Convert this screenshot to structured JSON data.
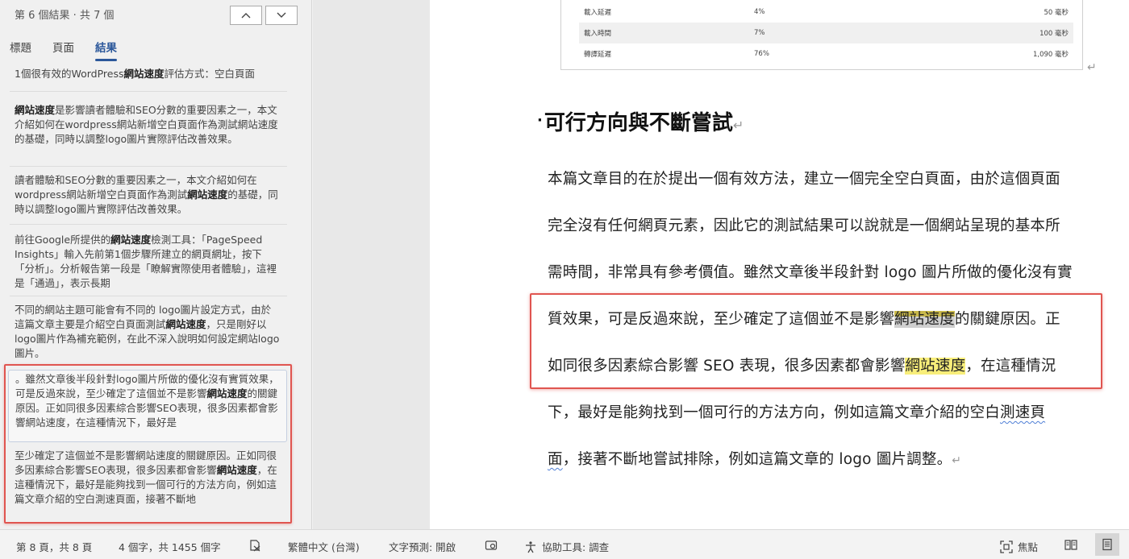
{
  "nav": {
    "count": "第 6 個結果 · 共 7 個",
    "tabs": [
      "標題",
      "頁面",
      "結果"
    ],
    "active_tab": "結果",
    "results": [
      {
        "parts": [
          "1個很有效的WordPress",
          "網站速度",
          "評估方式：空白頁面"
        ]
      },
      {
        "parts": [
          "",
          "網站速度",
          "是影響讀者體驗和SEO分數的重要因素之一，本文介紹如何在wordpress網站新增空白頁面作為測試網站速度的基礎，同時以調整logo圖片實際評估改善效果。"
        ]
      },
      {
        "parts": [
          "讀者體驗和SEO分數的重要因素之一，本文介紹如何在wordpress網站新增空白頁面作為測試",
          "網站速度",
          "的基礎，同時以調整logo圖片實際評估改善效果。"
        ]
      },
      {
        "parts": [
          "前往Google所提供的",
          "網站速度",
          "檢測工具：「PageSpeed Insights」輸入先前第1個步驟所建立的網頁網址，按下「分析」。分析報告第一段是「瞭解實際使用者體驗」，這裡是「通過」，表示長期"
        ]
      },
      {
        "parts": [
          "不同的網站主題可能會有不同的 logo圖片設定方式，由於這篇文章主要是介紹空白頁面測試",
          "網站速度",
          "，只是剛好以logo圖片作為補充範例，在此不深入說明如何設定網站logo圖片。"
        ]
      },
      {
        "parts": [
          "。雖然文章後半段針對logo圖片所做的優化沒有實質效果，可是反過來說，至少確定了這個並不是影響",
          "網站速度",
          "的關鍵原因。正如同很多因素綜合影響SEO表現，很多因素都會影響網站速度，在這種情況下，最好是"
        ]
      },
      {
        "parts": [
          "至少確定了這個並不是影響網站速度的關鍵原因。正如同很多因素綜合影響SEO表現，很多因素都會影響",
          "網站速度",
          "，在這種情況下，最好是能夠找到一個可行的方法方向，例如這篇文章介紹的空白測速頁面，接著不斷地"
        ]
      }
    ]
  },
  "doc": {
    "table_rows": [
      [
        "載入延遲",
        "4%",
        "50 毫秒"
      ],
      [
        "載入時間",
        "7%",
        "100 毫秒"
      ],
      [
        "轉譯延遲",
        "76%",
        "1,090 毫秒"
      ]
    ],
    "heading": "可行方向與不斷嘗試",
    "bullet": "·",
    "return_mark": "↵",
    "lines": {
      "l1": "本篇文章目的在於提出一個有效方法，建立一個完全空白頁面，由於這個頁面",
      "l2": "完全沒有任何網頁元素，因此它的測試結果可以說就是一個網站呈現的基本所",
      "l3": "需時間，非常具有參考價值。雖然文章後半段針對 logo 圖片所做的優化沒有實",
      "l4a": "質效果，可是反過來說，至少確定了這個並不是影響",
      "l4b": "網站速度",
      "l4c": "的關鍵原因。正",
      "l5a": "如同很多因素綜合影響 SEO 表現，很多因素都會影響",
      "l5b": "網站速度",
      "l5c": "，在這種情況",
      "l6a": "下，最好是能夠找到一個可行的方法方向，例如這篇文章介紹的空白",
      "l6b": "測速頁",
      "l7a": "面",
      "l7b": "，接著不斷地嘗試排除，例如這篇文章的 logo 圖片調整。"
    }
  },
  "status": {
    "page": "第 8 頁，共 8 頁",
    "words": "4 個字，共 1455 個字",
    "language": "繁體中文 (台灣)",
    "prediction": "文字預測: 開啟",
    "accessibility": "協助工具: 調查",
    "focus": "焦點"
  }
}
